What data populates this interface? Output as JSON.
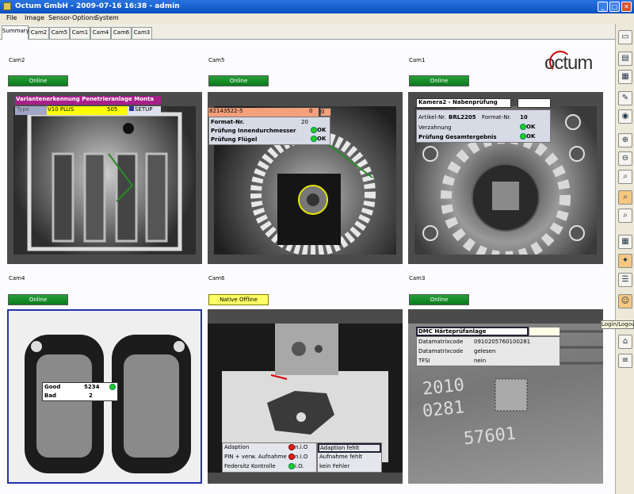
{
  "window": {
    "title": "Octum GmbH - 2009-07-16 16:38 - admin",
    "min": "_",
    "max": "□",
    "close": "✕"
  },
  "menu": [
    "File",
    "Image",
    "Sensor-Options",
    "System"
  ],
  "tabs": [
    "Summary",
    "Cam2",
    "Cam5",
    "Cam1",
    "Cam4",
    "Cam6",
    "Cam3"
  ],
  "logo": "octum",
  "tooltip": "Login/Logout",
  "cams": {
    "cam2": {
      "label": "Cam2",
      "status": "Online",
      "title": "Variantenerkennung Penetrieranlage Monta",
      "type_label": "Type",
      "variant": "V10 PLUS",
      "num": "505",
      "setup": "SETUP"
    },
    "cam5": {
      "label": "Cam5",
      "status": "Online",
      "part": "82143522-5",
      "v1": "0",
      "v2": "0",
      "format_label": "Format-Nr.",
      "format": "20",
      "check1": "Prüfung Innendurchmesser",
      "check2": "Prüfung Flügel",
      "ok": "OK"
    },
    "cam1": {
      "label": "Cam1",
      "status": "Online",
      "title": "Kamera2 - Nabenprüfung",
      "art_label": "Artikel-Nr.",
      "art": "BRL2205",
      "fmt_label": "Format-Nr.",
      "fmt": "10",
      "line1": "Verzahnung",
      "line2": "Prüfung Gesamtergebnis",
      "ok": "OK"
    },
    "cam4": {
      "label": "Cam4",
      "status": "Online",
      "good_label": "Good",
      "good": "5234",
      "bad_label": "Bad",
      "bad": "2"
    },
    "cam6": {
      "label": "Cam6",
      "status": "Native Offline",
      "rows": [
        {
          "name": "Adaption",
          "state": "n.i.O",
          "result": "Adaption fehlt"
        },
        {
          "name": "PIN + verw. Aufnahme",
          "state": "n.i.O",
          "result": "Aufnahme fehlt"
        },
        {
          "name": "Federsitz Kontrolle",
          "state": "i.O.",
          "result": "kein Fehler"
        }
      ]
    },
    "cam3": {
      "label": "Cam3",
      "status": "Online",
      "title": "DMC Härteprüfanlage Verfahrwagen",
      "rows": [
        {
          "k": "Datamatrixcode",
          "v": "0910205760100281"
        },
        {
          "k": "Datamatrixcode",
          "v": "gelesen"
        },
        {
          "k": "TFSI",
          "v": "nein"
        }
      ],
      "engraved": [
        "2010",
        "0281",
        "57601"
      ]
    }
  }
}
